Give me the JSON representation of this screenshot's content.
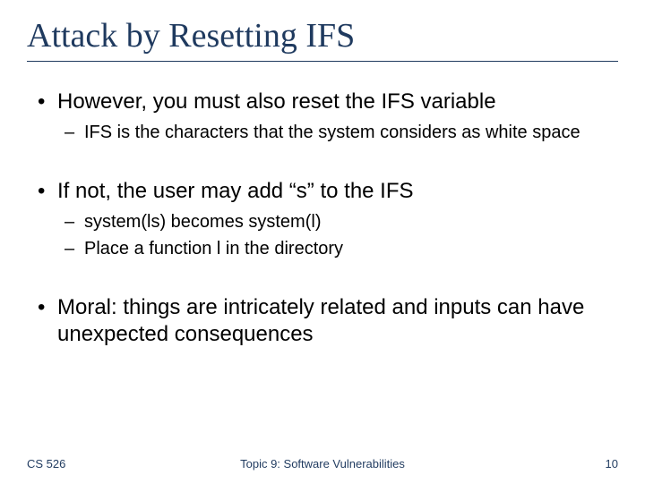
{
  "title": "Attack by Resetting IFS",
  "bullets": [
    {
      "text": "However, you must also reset the IFS variable",
      "sub": [
        "IFS is the characters that the system considers as white space"
      ]
    },
    {
      "text": "If not, the user may add “s” to the IFS",
      "sub": [
        "system(ls) becomes system(l)",
        "Place a function l in the directory"
      ]
    },
    {
      "text": "Moral: things are intricately related and inputs can have unexpected consequences",
      "sub": []
    }
  ],
  "footer": {
    "left": "CS 526",
    "center": "Topic 9: Software Vulnerabilities",
    "right": "10"
  }
}
